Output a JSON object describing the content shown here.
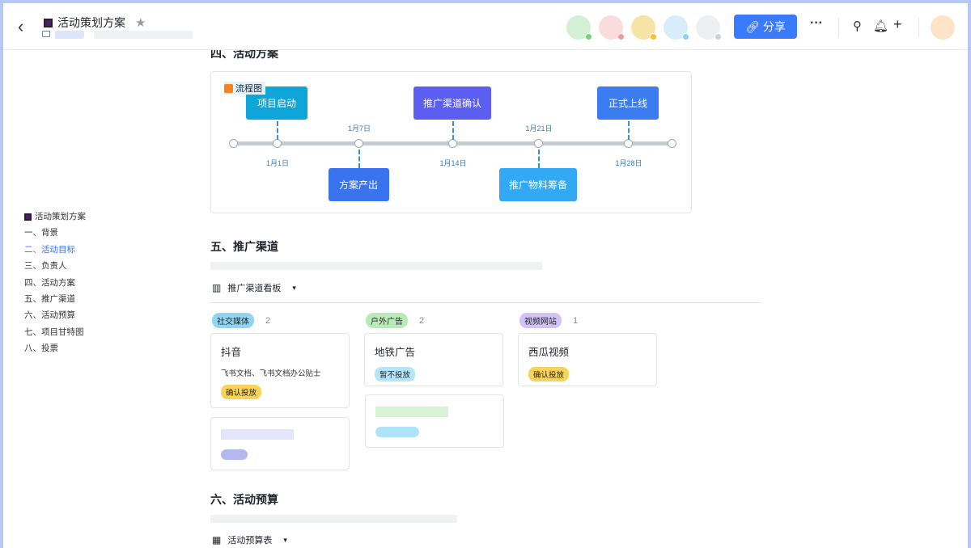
{
  "header": {
    "title": "活动策划方案",
    "share_label": "分享",
    "more": "···"
  },
  "avatars": [
    {
      "bg": "#d4f0d4",
      "dot": "#7ccf7c"
    },
    {
      "bg": "#fbdcdc",
      "dot": "#ef9a9a"
    },
    {
      "bg": "#f6e3a6",
      "dot": "#f2c230"
    },
    {
      "bg": "#d7eefa",
      "dot": "#8fd0f0"
    },
    {
      "bg": "#eeeff1",
      "dot": "#cfd1d5"
    }
  ],
  "toc": {
    "items": [
      "活动策划方案",
      "一、背景",
      "二、活动目标",
      "三、负责人",
      "四、活动方案",
      "五、推广渠道",
      "六、活动预算",
      "七、项目甘特图",
      "八、投票"
    ]
  },
  "sections": {
    "s4": "四、活动方案",
    "s5": "五、推广渠道",
    "s6": "六、活动预算"
  },
  "flow": {
    "label": "流程图",
    "milestones": [
      {
        "name": "项目启动",
        "date": "1月1日",
        "color": "#0ea5d8"
      },
      {
        "name": "方案产出",
        "date": "1月7日",
        "color": "#3a73ee"
      },
      {
        "name": "推广渠道确认",
        "date": "1月14日",
        "color": "#5b5ef0"
      },
      {
        "name": "推广物料筹备",
        "date": "1月21日",
        "color": "#33a8f5"
      },
      {
        "name": "正式上线",
        "date": "1月28日",
        "color": "#3b7cf0"
      }
    ]
  },
  "kanban": {
    "view_label": "推广渠道看板",
    "columns": [
      {
        "tag": "社交媒体",
        "count": "2",
        "color": "#8fd6f5",
        "cards": [
          {
            "title": "抖音",
            "desc": "飞书文档、飞书文档办公贴士",
            "status": "确认投放"
          }
        ]
      },
      {
        "tag": "户外广告",
        "count": "2",
        "color": "#b9ebb9",
        "cards": [
          {
            "title": "地铁广告",
            "status": "暂不投放"
          }
        ]
      },
      {
        "tag": "视频网站",
        "count": "1",
        "color": "#d2c2f5",
        "cards": [
          {
            "title": "西瓜视频",
            "status": "确认投放"
          }
        ]
      }
    ]
  },
  "budget": {
    "view_label": "活动预算表"
  }
}
